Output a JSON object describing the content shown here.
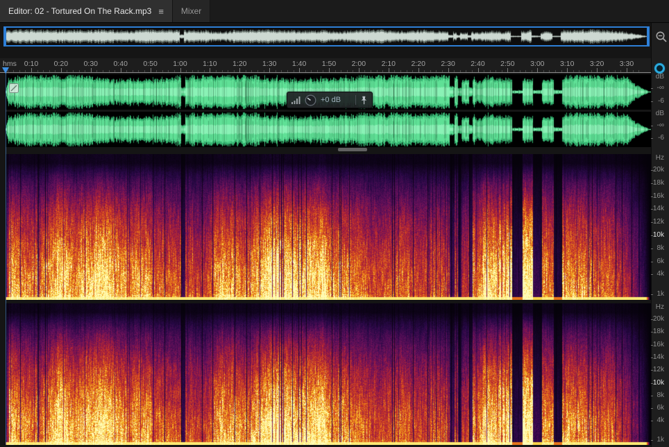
{
  "tabs": {
    "editor_label": "Editor: 02 - Tortured On The Rack.mp3",
    "editor_menu_icon": "≡",
    "mixer_label": "Mixer"
  },
  "ruler": {
    "unit_label": "hms",
    "time_labels": [
      "0:10",
      "0:20",
      "0:30",
      "0:40",
      "0:50",
      "1:00",
      "1:10",
      "1:20",
      "1:30",
      "1:40",
      "1:50",
      "2:00",
      "2:10",
      "2:20",
      "2:30",
      "2:40",
      "2:50",
      "3:00",
      "3:10",
      "3:20",
      "3:30"
    ]
  },
  "hud": {
    "gain_value": "+0 dB"
  },
  "waveform_scale": {
    "unit": "dB",
    "ticks": [
      "-∞",
      "-6"
    ]
  },
  "spectrogram_scale": {
    "unit": "Hz",
    "labels": [
      "20k",
      "18k",
      "16k",
      "14k",
      "12k",
      "10k",
      "8k",
      "6k",
      "4k",
      "1k"
    ],
    "highlight": "10k"
  },
  "colors": {
    "accent_blue": "#2e7fd6",
    "waveform_green": "#5fe096",
    "playhead_blue": "#3f8fe2",
    "spectrogram_hot": "#f7be1e"
  }
}
